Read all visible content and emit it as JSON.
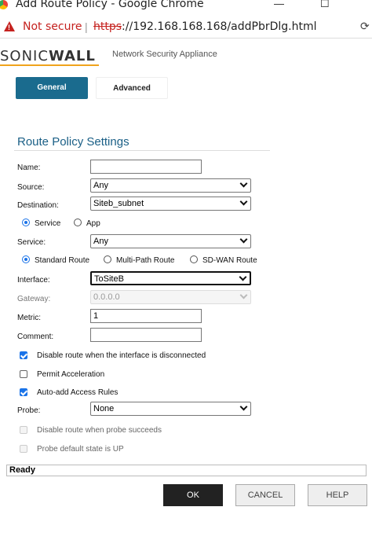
{
  "window": {
    "title": "Add Route Policy - Google Chrome",
    "controls": [
      "—",
      "☐"
    ]
  },
  "address_bar": {
    "security": "Not secure",
    "scheme": "https",
    "url_rest": "://192.168.168.168/addPbrDlg.html"
  },
  "header": {
    "brand_sonic": "SONIC",
    "brand_wall": "WALL",
    "subtitle": "Network Security Appliance"
  },
  "tabs": [
    {
      "label": "General",
      "active": true
    },
    {
      "label": "Advanced",
      "active": false
    }
  ],
  "section_title": "Route Policy Settings",
  "form": {
    "name_label": "Name:",
    "name_value": "",
    "source_label": "Source:",
    "source_value": "Any",
    "destination_label": "Destination:",
    "destination_value": "Siteb_subnet",
    "type_radios": [
      {
        "label": "Service",
        "selected": true
      },
      {
        "label": "App",
        "selected": false
      }
    ],
    "service_label": "Service:",
    "service_value": "Any",
    "route_radios": [
      {
        "label": "Standard Route",
        "selected": true
      },
      {
        "label": "Multi-Path Route",
        "selected": false
      },
      {
        "label": "SD-WAN Route",
        "selected": false
      }
    ],
    "interface_label": "Interface:",
    "interface_value": "ToSiteB",
    "gateway_label": "Gateway:",
    "gateway_value": "0.0.0.0",
    "metric_label": "Metric:",
    "metric_value": "1",
    "comment_label": "Comment:",
    "comment_value": "",
    "checkboxes": [
      {
        "label": "Disable route when the interface is disconnected",
        "checked": true,
        "enabled": true
      },
      {
        "label": "Permit Acceleration",
        "checked": false,
        "enabled": true
      },
      {
        "label": "Auto-add Access Rules",
        "checked": true,
        "enabled": true
      }
    ],
    "probe_label": "Probe:",
    "probe_value": "None",
    "probe_checkboxes": [
      {
        "label": "Disable route when probe succeeds",
        "checked": false,
        "enabled": false
      },
      {
        "label": "Probe default state is UP",
        "checked": false,
        "enabled": false
      }
    ]
  },
  "status": "Ready",
  "buttons": {
    "ok": "OK",
    "cancel": "CANCEL",
    "help": "HELP"
  },
  "colors": {
    "accent": "#1a6b8e",
    "warning": "#c5221f",
    "brand_underline": "#f0a31c"
  }
}
